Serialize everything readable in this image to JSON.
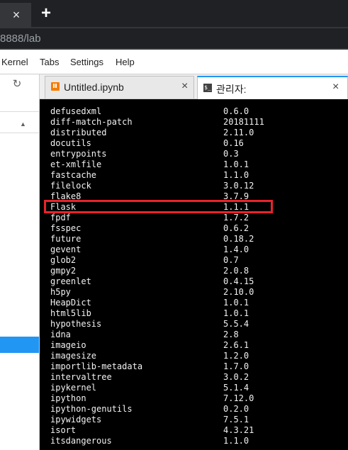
{
  "browser": {
    "new_tab_label": "+",
    "close_tab_label": "×",
    "url": "8888/lab"
  },
  "menu": {
    "items": [
      "Kernel",
      "Tabs",
      "Settings",
      "Help"
    ]
  },
  "left_panel": {
    "refresh_icon": "refresh-icon",
    "sort_icon": "sort-up-icon"
  },
  "doc_tabs": [
    {
      "label": "Untitled.ipynb",
      "icon": "notebook-icon",
      "close": "×"
    },
    {
      "label": "관리자:",
      "icon": "terminal-icon",
      "close": "×"
    }
  ],
  "terminal": {
    "packages": [
      {
        "name": "defusedxml",
        "version": "0.6.0"
      },
      {
        "name": "diff-match-patch",
        "version": "20181111"
      },
      {
        "name": "distributed",
        "version": "2.11.0"
      },
      {
        "name": "docutils",
        "version": "0.16"
      },
      {
        "name": "entrypoints",
        "version": "0.3"
      },
      {
        "name": "et-xmlfile",
        "version": "1.0.1"
      },
      {
        "name": "fastcache",
        "version": "1.1.0"
      },
      {
        "name": "filelock",
        "version": "3.0.12"
      },
      {
        "name": "flake8",
        "version": "3.7.9"
      },
      {
        "name": "Flask",
        "version": "1.1.1"
      },
      {
        "name": "fpdf",
        "version": "1.7.2"
      },
      {
        "name": "fsspec",
        "version": "0.6.2"
      },
      {
        "name": "future",
        "version": "0.18.2"
      },
      {
        "name": "gevent",
        "version": "1.4.0"
      },
      {
        "name": "glob2",
        "version": "0.7"
      },
      {
        "name": "gmpy2",
        "version": "2.0.8"
      },
      {
        "name": "greenlet",
        "version": "0.4.15"
      },
      {
        "name": "h5py",
        "version": "2.10.0"
      },
      {
        "name": "HeapDict",
        "version": "1.0.1"
      },
      {
        "name": "html5lib",
        "version": "1.0.1"
      },
      {
        "name": "hypothesis",
        "version": "5.5.4"
      },
      {
        "name": "idna",
        "version": "2.8"
      },
      {
        "name": "imageio",
        "version": "2.6.1"
      },
      {
        "name": "imagesize",
        "version": "1.2.0"
      },
      {
        "name": "importlib-metadata",
        "version": "1.7.0"
      },
      {
        "name": "intervaltree",
        "version": "3.0.2"
      },
      {
        "name": "ipykernel",
        "version": "5.1.4"
      },
      {
        "name": "ipython",
        "version": "7.12.0"
      },
      {
        "name": "ipython-genutils",
        "version": "0.2.0"
      },
      {
        "name": "ipywidgets",
        "version": "7.5.1"
      },
      {
        "name": "isort",
        "version": "4.3.21"
      },
      {
        "name": "itsdangerous",
        "version": "1.1.0"
      }
    ],
    "highlighted_package": "Flask",
    "highlight_color": "#e8232b"
  }
}
